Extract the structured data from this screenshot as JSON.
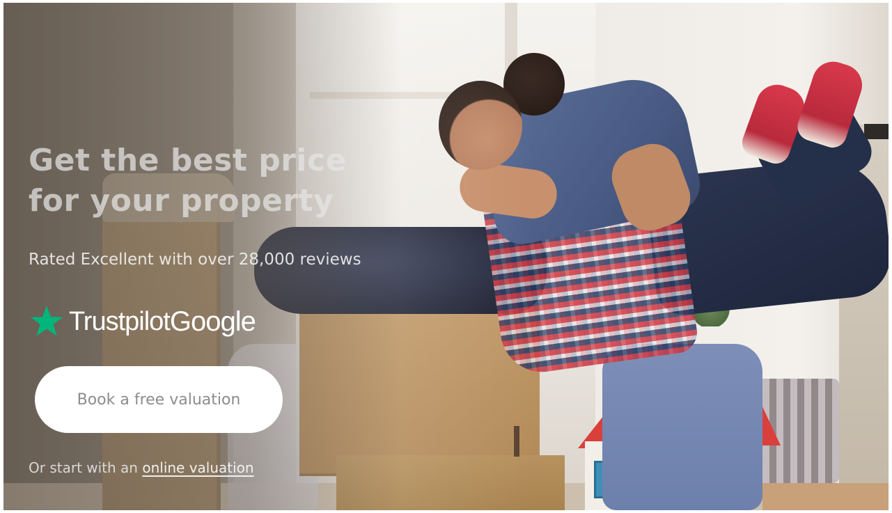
{
  "hero": {
    "headline_line1": "Get the best price",
    "headline_line2": "for your property",
    "rating_text": "Rated Excellent with over 28,000 reviews",
    "cta_label": "Book a free valuation",
    "alt_prefix": "Or start with an",
    "alt_link": "online valuation"
  },
  "logos": {
    "trustpilot": "Trustpilot",
    "google": "Google",
    "trustpilot_star_color": "#00b67a"
  },
  "photo": {
    "icon": "hero-photo-couple-moving-boxes"
  }
}
